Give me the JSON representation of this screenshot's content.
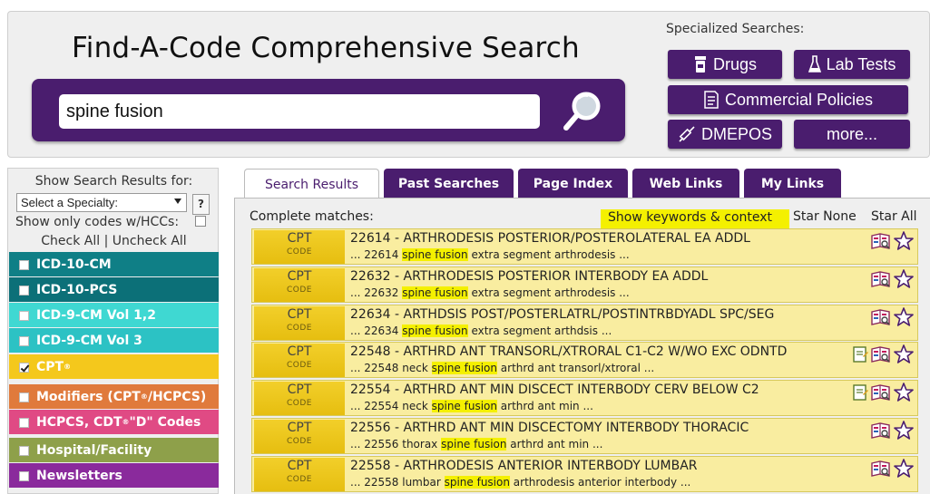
{
  "header": {
    "title": "Find-A-Code Comprehensive Search",
    "search_value": "spine fusion",
    "specialized_label": "Specialized Searches:",
    "buttons": {
      "drugs": "Drugs",
      "lab_tests": "Lab Tests",
      "commercial_policies": "Commercial Policies",
      "dmepos": "DMEPOS",
      "more": "more..."
    }
  },
  "sidebar": {
    "show_results_for": "Show Search Results for:",
    "specialty_select": "Select a Specialty:",
    "help": "?",
    "hcc_label": "Show only codes w/HCCs:",
    "check_all": "Check All",
    "separator": "|",
    "uncheck_all": "Uncheck All",
    "categories": [
      {
        "label": "ICD-10-CM",
        "color": "#0f7f86",
        "checked": false
      },
      {
        "label": "ICD-10-PCS",
        "color": "#0c7078",
        "checked": false
      },
      {
        "label": "ICD-9-CM Vol 1,2",
        "color": "#3fd8d2",
        "checked": false
      },
      {
        "label": "ICD-9-CM Vol 3",
        "color": "#2cc2c4",
        "checked": false
      },
      {
        "label": "CPT",
        "sup": "®",
        "color": "#f4c81c",
        "checked": true
      },
      {
        "label": "Modifiers (CPT",
        "sup": "®",
        "label_tail": "/HCPCS)",
        "color": "#e07a3c",
        "checked": false
      },
      {
        "label": "HCPCS, CDT",
        "sup": "®",
        "label_tail": " \"D\" Codes",
        "color": "#e04a84",
        "checked": false
      },
      {
        "label": "Hospital/Facility",
        "color": "#8ea04a",
        "checked": false
      },
      {
        "label": "Newsletters",
        "color": "#8a2a9c",
        "checked": false
      }
    ]
  },
  "tabs": [
    {
      "label": "Search Results",
      "active": true
    },
    {
      "label": "Past Searches",
      "active": false
    },
    {
      "label": "Page Index",
      "active": false
    },
    {
      "label": "Web Links",
      "active": false
    },
    {
      "label": "My Links",
      "active": false
    }
  ],
  "results": {
    "complete_matches": "Complete matches:",
    "show_keywords": "Show keywords & context",
    "star_none": "Star None",
    "star_all": "Star All",
    "badge_line1": "CPT",
    "badge_line2": "CODE",
    "rows": [
      {
        "title": "22614 - ARTHRODESIS POSTERIOR/POSTEROLATERAL EA ADDL",
        "pre": "... 22614 ",
        "hl": "spine fusion",
        "post": " extra segment arthrodesis ...",
        "note_icon": false
      },
      {
        "title": "22632 - ARTHRODESIS POSTERIOR INTERBODY EA ADDL",
        "pre": "... 22632 ",
        "hl": "spine fusion",
        "post": " extra segment arthrodesis ...",
        "note_icon": false
      },
      {
        "title": "22634 - ARTHDSIS POST/POSTERLATRL/POSTINTRBDYADL SPC/SEG",
        "pre": "... 22634 ",
        "hl": "spine fusion",
        "post": " extra segment arthdsis ...",
        "note_icon": false
      },
      {
        "title": "22548 - ARTHRD ANT TRANSORL/XTRORAL C1-C2 W/WO EXC ODNTD",
        "pre": "... 22548 neck ",
        "hl": "spine fusion",
        "post": " arthrd ant transorl/xtroral ...",
        "note_icon": true
      },
      {
        "title": "22554 - ARTHRD ANT MIN DISCECT INTERBODY CERV BELOW C2",
        "pre": "... 22554 neck ",
        "hl": "spine fusion",
        "post": " arthrd ant min ...",
        "note_icon": true
      },
      {
        "title": "22556 - ARTHRD ANT MIN DISCECTOMY INTERBODY THORACIC",
        "pre": "... 22556 thorax ",
        "hl": "spine fusion",
        "post": " arthrd ant min ...",
        "note_icon": false
      },
      {
        "title": "22558 - ARTHRODESIS ANTERIOR INTERBODY LUMBAR",
        "pre": "... 22558 lumbar ",
        "hl": "spine fusion",
        "post": " arthrodesis anterior interbody ...",
        "note_icon": false
      }
    ]
  }
}
